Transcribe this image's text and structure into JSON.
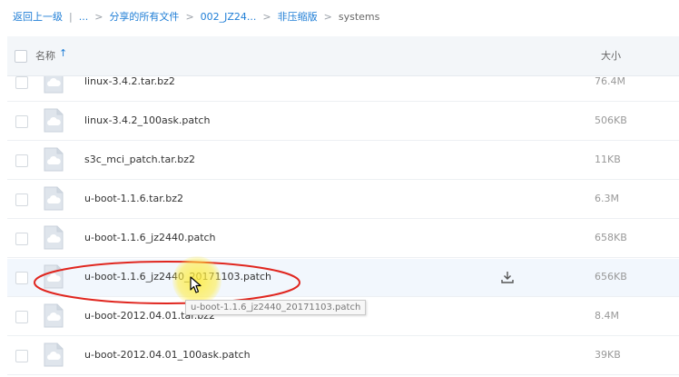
{
  "breadcrumb": {
    "back": "返回上一级",
    "divider": "|",
    "ellipsis": "...",
    "separator": ">",
    "crumb1": "分享的所有文件",
    "crumb2": "002_JZ24...",
    "crumb3": "非压缩版",
    "current": "systems"
  },
  "table": {
    "name_header": "名称",
    "sort_indicator": "↑",
    "size_header": "大小"
  },
  "icons": {
    "file": "cloud-file-icon",
    "download": "download-icon",
    "cursor": "mouse-cursor-icon"
  },
  "files": [
    {
      "name": "linux-3.4.2.tar.bz2",
      "size": "76.4M"
    },
    {
      "name": "linux-3.4.2_100ask.patch",
      "size": "506KB"
    },
    {
      "name": "s3c_mci_patch.tar.bz2",
      "size": "11KB"
    },
    {
      "name": "u-boot-1.1.6.tar.bz2",
      "size": "6.3M"
    },
    {
      "name": "u-boot-1.1.6_jz2440.patch",
      "size": "658KB"
    },
    {
      "name": "u-boot-1.1.6_jz2440_20171103.patch",
      "size": "656KB"
    },
    {
      "name": "u-boot-2012.04.01.tar.bz2",
      "size": "8.4M"
    },
    {
      "name": "u-boot-2012.04.01_100ask.patch",
      "size": "39KB"
    }
  ],
  "tooltip": "u-boot-1.1.6_jz2440_20171103.patch",
  "colors": {
    "link": "#1f7ed6",
    "header_bg": "#f3f6f9",
    "hover_row": "#f2f7fd",
    "annotation": "#e0261f",
    "cursor_highlight": "#ffec3c"
  }
}
